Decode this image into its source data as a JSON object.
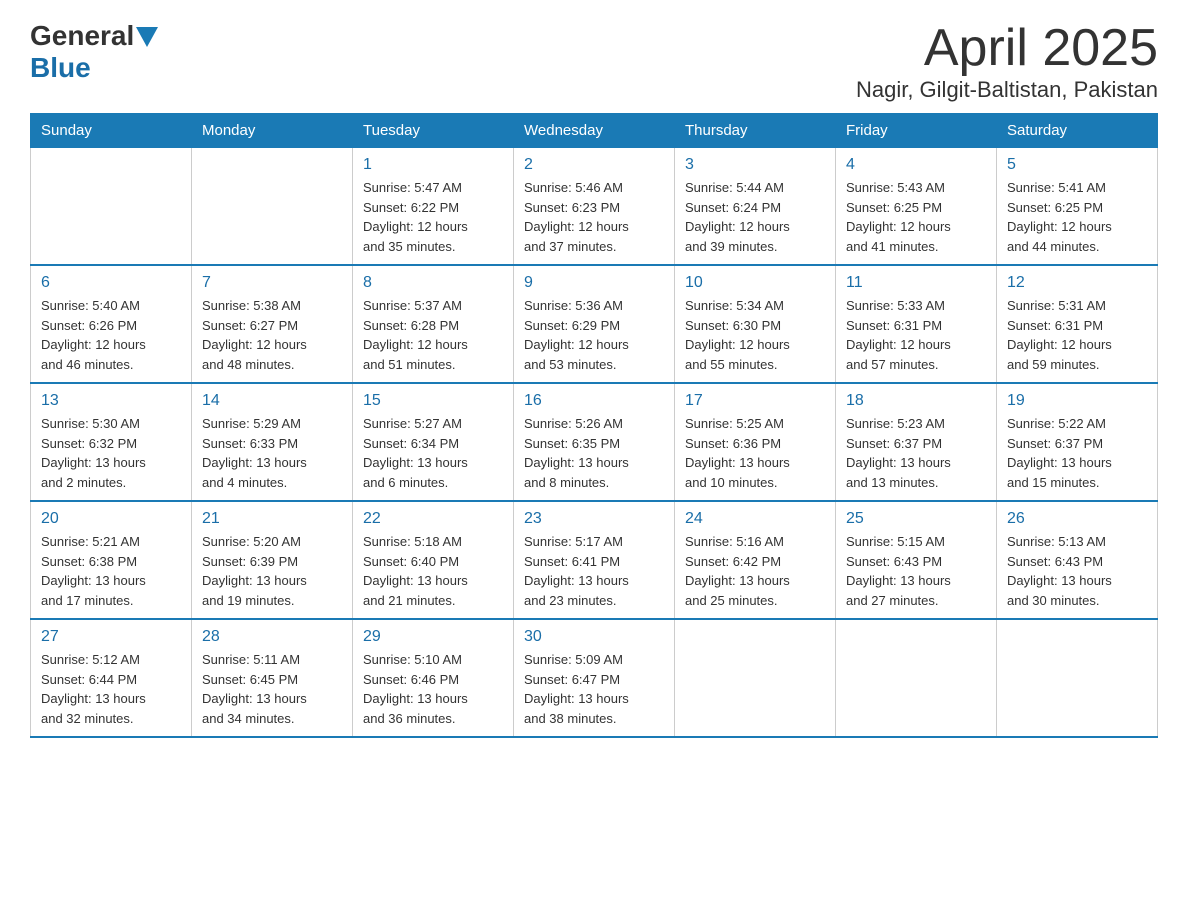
{
  "logo": {
    "text_general": "General",
    "text_blue": "Blue"
  },
  "title": "April 2025",
  "subtitle": "Nagir, Gilgit-Baltistan, Pakistan",
  "weekdays": [
    "Sunday",
    "Monday",
    "Tuesday",
    "Wednesday",
    "Thursday",
    "Friday",
    "Saturday"
  ],
  "weeks": [
    [
      {
        "day": "",
        "info": ""
      },
      {
        "day": "",
        "info": ""
      },
      {
        "day": "1",
        "info": "Sunrise: 5:47 AM\nSunset: 6:22 PM\nDaylight: 12 hours\nand 35 minutes."
      },
      {
        "day": "2",
        "info": "Sunrise: 5:46 AM\nSunset: 6:23 PM\nDaylight: 12 hours\nand 37 minutes."
      },
      {
        "day": "3",
        "info": "Sunrise: 5:44 AM\nSunset: 6:24 PM\nDaylight: 12 hours\nand 39 minutes."
      },
      {
        "day": "4",
        "info": "Sunrise: 5:43 AM\nSunset: 6:25 PM\nDaylight: 12 hours\nand 41 minutes."
      },
      {
        "day": "5",
        "info": "Sunrise: 5:41 AM\nSunset: 6:25 PM\nDaylight: 12 hours\nand 44 minutes."
      }
    ],
    [
      {
        "day": "6",
        "info": "Sunrise: 5:40 AM\nSunset: 6:26 PM\nDaylight: 12 hours\nand 46 minutes."
      },
      {
        "day": "7",
        "info": "Sunrise: 5:38 AM\nSunset: 6:27 PM\nDaylight: 12 hours\nand 48 minutes."
      },
      {
        "day": "8",
        "info": "Sunrise: 5:37 AM\nSunset: 6:28 PM\nDaylight: 12 hours\nand 51 minutes."
      },
      {
        "day": "9",
        "info": "Sunrise: 5:36 AM\nSunset: 6:29 PM\nDaylight: 12 hours\nand 53 minutes."
      },
      {
        "day": "10",
        "info": "Sunrise: 5:34 AM\nSunset: 6:30 PM\nDaylight: 12 hours\nand 55 minutes."
      },
      {
        "day": "11",
        "info": "Sunrise: 5:33 AM\nSunset: 6:31 PM\nDaylight: 12 hours\nand 57 minutes."
      },
      {
        "day": "12",
        "info": "Sunrise: 5:31 AM\nSunset: 6:31 PM\nDaylight: 12 hours\nand 59 minutes."
      }
    ],
    [
      {
        "day": "13",
        "info": "Sunrise: 5:30 AM\nSunset: 6:32 PM\nDaylight: 13 hours\nand 2 minutes."
      },
      {
        "day": "14",
        "info": "Sunrise: 5:29 AM\nSunset: 6:33 PM\nDaylight: 13 hours\nand 4 minutes."
      },
      {
        "day": "15",
        "info": "Sunrise: 5:27 AM\nSunset: 6:34 PM\nDaylight: 13 hours\nand 6 minutes."
      },
      {
        "day": "16",
        "info": "Sunrise: 5:26 AM\nSunset: 6:35 PM\nDaylight: 13 hours\nand 8 minutes."
      },
      {
        "day": "17",
        "info": "Sunrise: 5:25 AM\nSunset: 6:36 PM\nDaylight: 13 hours\nand 10 minutes."
      },
      {
        "day": "18",
        "info": "Sunrise: 5:23 AM\nSunset: 6:37 PM\nDaylight: 13 hours\nand 13 minutes."
      },
      {
        "day": "19",
        "info": "Sunrise: 5:22 AM\nSunset: 6:37 PM\nDaylight: 13 hours\nand 15 minutes."
      }
    ],
    [
      {
        "day": "20",
        "info": "Sunrise: 5:21 AM\nSunset: 6:38 PM\nDaylight: 13 hours\nand 17 minutes."
      },
      {
        "day": "21",
        "info": "Sunrise: 5:20 AM\nSunset: 6:39 PM\nDaylight: 13 hours\nand 19 minutes."
      },
      {
        "day": "22",
        "info": "Sunrise: 5:18 AM\nSunset: 6:40 PM\nDaylight: 13 hours\nand 21 minutes."
      },
      {
        "day": "23",
        "info": "Sunrise: 5:17 AM\nSunset: 6:41 PM\nDaylight: 13 hours\nand 23 minutes."
      },
      {
        "day": "24",
        "info": "Sunrise: 5:16 AM\nSunset: 6:42 PM\nDaylight: 13 hours\nand 25 minutes."
      },
      {
        "day": "25",
        "info": "Sunrise: 5:15 AM\nSunset: 6:43 PM\nDaylight: 13 hours\nand 27 minutes."
      },
      {
        "day": "26",
        "info": "Sunrise: 5:13 AM\nSunset: 6:43 PM\nDaylight: 13 hours\nand 30 minutes."
      }
    ],
    [
      {
        "day": "27",
        "info": "Sunrise: 5:12 AM\nSunset: 6:44 PM\nDaylight: 13 hours\nand 32 minutes."
      },
      {
        "day": "28",
        "info": "Sunrise: 5:11 AM\nSunset: 6:45 PM\nDaylight: 13 hours\nand 34 minutes."
      },
      {
        "day": "29",
        "info": "Sunrise: 5:10 AM\nSunset: 6:46 PM\nDaylight: 13 hours\nand 36 minutes."
      },
      {
        "day": "30",
        "info": "Sunrise: 5:09 AM\nSunset: 6:47 PM\nDaylight: 13 hours\nand 38 minutes."
      },
      {
        "day": "",
        "info": ""
      },
      {
        "day": "",
        "info": ""
      },
      {
        "day": "",
        "info": ""
      }
    ]
  ]
}
